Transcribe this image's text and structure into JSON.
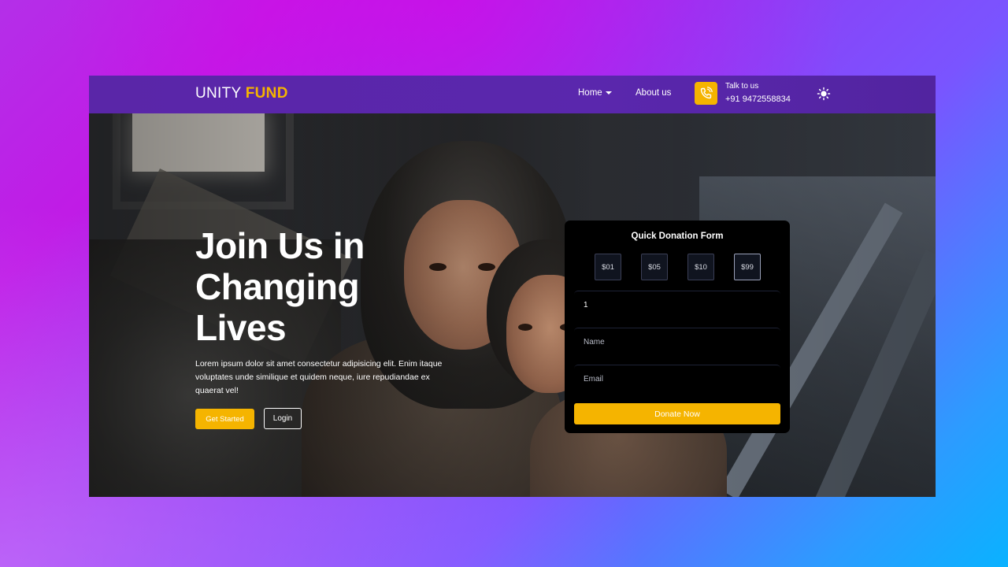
{
  "nav": {
    "brand_part1": "UNITY ",
    "brand_part2": "FUND",
    "home_label": "Home",
    "about_label": "About us",
    "talk_label": "Talk to us",
    "talk_number": "+91 9472558834"
  },
  "hero": {
    "title": "Join Us in Changing Lives",
    "text": "Lorem ipsum dolor sit amet consectetur adipisicing elit. Enim itaque voluptates unde similique et quidem neque, iure repudiandae ex quaerat vel!",
    "start_label": "Get Started",
    "login_label": "Login"
  },
  "form": {
    "title": "Quick Donation Form",
    "amounts": [
      "$01",
      "$05",
      "$10",
      "$99"
    ],
    "selected_amount": "$99",
    "quantity_value": "1",
    "name_placeholder": "Name",
    "email_placeholder": "Email",
    "donate_label": "Donate Now"
  },
  "colors": {
    "accent": "#f5b400",
    "nav_bg": "#5a26a8",
    "form_bg": "#000000"
  },
  "icons": {
    "phone": "phone-icon",
    "theme": "sun-icon",
    "caret": "chevron-down-icon"
  }
}
